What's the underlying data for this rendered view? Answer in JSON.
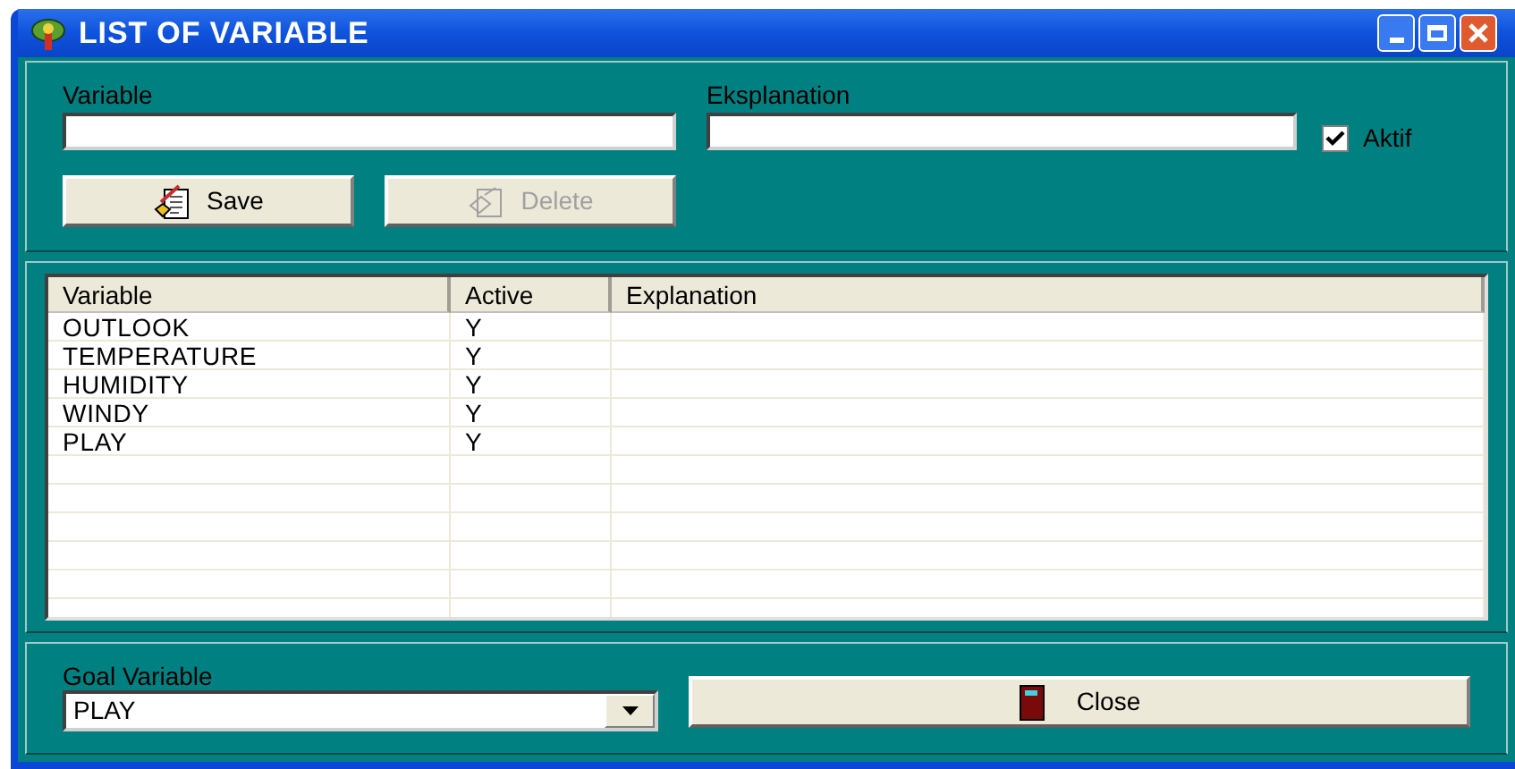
{
  "window": {
    "title": "LIST OF VARIABLE"
  },
  "form": {
    "variable_label": {
      "text": "Variable"
    },
    "explanation_label": {
      "text": "Eksplanation"
    },
    "aktif": {
      "label": "Aktif",
      "checked": true
    },
    "buttons": [
      {
        "label": "Save",
        "disabled": false,
        "kind": "save"
      },
      {
        "label": "Delete",
        "disabled": true,
        "kind": "delete"
      }
    ]
  },
  "table": {
    "columns": [
      "Variable",
      "Active",
      "Explanation"
    ],
    "rows": [
      [
        "OUTLOOK",
        "Y"
      ],
      [
        "TEMPERATURE",
        "Y"
      ],
      [
        "HUMIDITY",
        "Y"
      ],
      [
        "WINDY",
        "Y"
      ],
      [
        "PLAY",
        "Y"
      ]
    ]
  },
  "goal": {
    "label": {
      "text": "Goal Variable"
    },
    "value": "PLAY"
  },
  "close_button": {
    "label": "Close"
  }
}
